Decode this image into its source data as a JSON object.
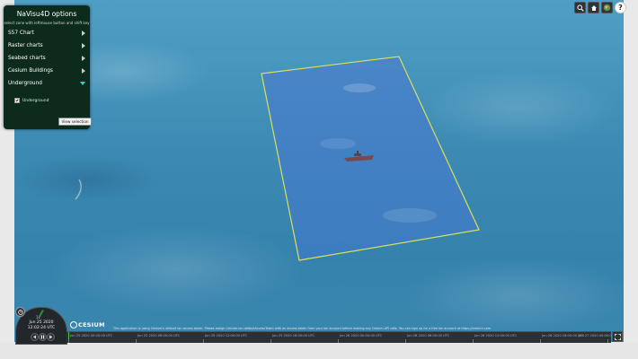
{
  "options_panel": {
    "title": "NaVisu4D options",
    "subtitle": "select zone with leftmouse button and shift key",
    "items": [
      {
        "label": "S57 Chart",
        "expanded": false
      },
      {
        "label": "Raster charts",
        "expanded": false
      },
      {
        "label": "Seabed charts",
        "expanded": false
      },
      {
        "label": "Cesium Buildings",
        "expanded": false
      },
      {
        "label": "Underground",
        "expanded": true
      }
    ],
    "checkbox_label": "Underground",
    "checkbox_checked": true,
    "view_button_label": "View selection"
  },
  "toolbar": {
    "icons": [
      "search-icon",
      "home-icon",
      "layers-icon",
      "help-icon"
    ],
    "help_label": "?"
  },
  "animation": {
    "speed": "1x",
    "date": "Jun 25 2020",
    "time": "12:02:24 UTC"
  },
  "logo": "CESIUM",
  "credit": "This application is using Cesium's default ion access token. Please assign Cesium.Ion.defaultAccessToken with an access token from your ion account before making any Cesium API calls. You can sign up for a free ion account at https://cesium.com",
  "timeline": {
    "labels": [
      "Jun 25 2020 00:00:00 UTC",
      "Jun 25 2020 06:00:00 UTC",
      "Jun 25 2020 12:00:00 UTC",
      "Jun 25 2020 18:00:00 UTC",
      "Jun 26 2020 00:00:00 UTC",
      "Jun 26 2020 06:00:00 UTC",
      "Jun 26 2020 12:00:00 UTC",
      "Jun 26 2020 18:00:00 UTC",
      "Jun 27 2020 00:00:00 UTC"
    ]
  },
  "colors": {
    "panel_bg": "#0c2b1c",
    "selection_outline": "#d8e05a",
    "expanded_arrow": "#23d6d0"
  }
}
